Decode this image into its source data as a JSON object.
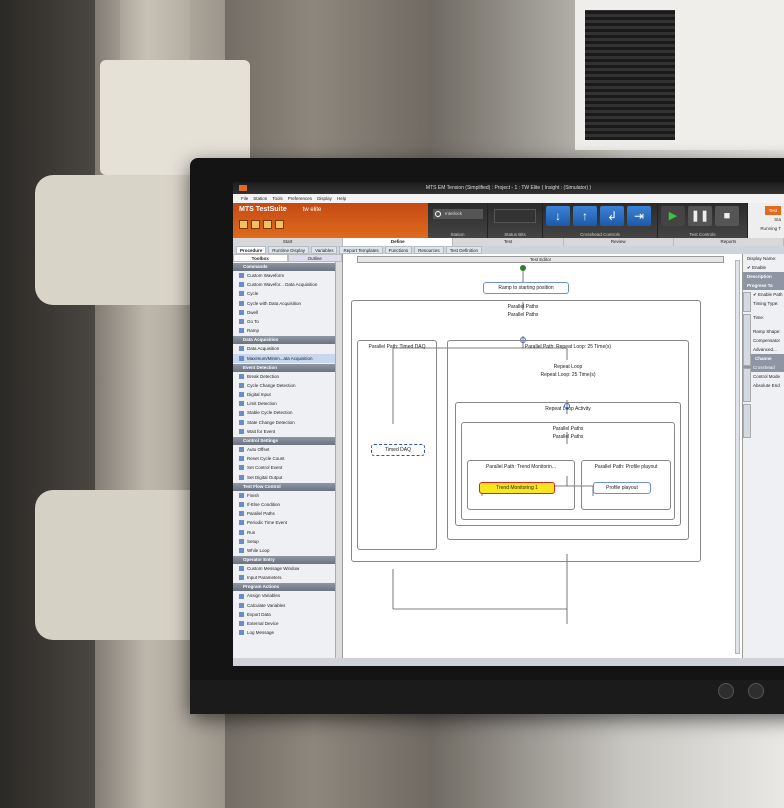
{
  "window": {
    "title": "MTS EM Tension (Simplified) : Project - 1 : TW Elite ( Insight : (Simulator) )"
  },
  "menu": [
    "File",
    "Station",
    "Tools",
    "Preferences",
    "Display",
    "Help"
  ],
  "brand": {
    "name": "MTS TestSuite",
    "edition": "tw elite"
  },
  "ribbon": {
    "station_field": "Interlock",
    "station_label": "Station",
    "status_bits_label": "Status Bits",
    "crosshead_label": "Crosshead Controls",
    "test_controls_label": "Test Controls",
    "right_top": "Test",
    "right_mid": "Sta",
    "right_bottom": "Running T"
  },
  "workflow_tabs": [
    "Start",
    "Define",
    "Test",
    "Review",
    "Reports"
  ],
  "define_tabs": [
    "Procedure",
    "Runtime Display",
    "Variables",
    "Report Templates",
    "Functions",
    "Resources",
    "Test Definition"
  ],
  "toolbox": {
    "tabs": [
      "Toolbox",
      "Outline"
    ],
    "sections": [
      {
        "title": "Commands",
        "items": [
          "Custom Waveform",
          "Custom Wavefor... Data Acquisition",
          "Cycle",
          "Cycle with Data Acquisition",
          "Dwell",
          "Go To",
          "Ramp"
        ]
      },
      {
        "title": "Data Acquisition",
        "items": [
          "Data Acquisition",
          "Maximum/Minim...ata Acquisition"
        ]
      },
      {
        "title": "Event Detection",
        "items": [
          "Break Detection",
          "Cycle Change Detection",
          "Digital Input",
          "Limit Detection",
          "Stable Cycle Detection",
          "State Change Detection",
          "Wait for Event"
        ]
      },
      {
        "title": "Control Settings",
        "items": [
          "Auto Offset",
          "Reset Cycle Count",
          "Set Control Event",
          "Set Digital Output"
        ]
      },
      {
        "title": "Test Flow Control",
        "items": [
          "Finish",
          "If-Else Condition",
          "Parallel Paths",
          "Periodic Time Event",
          "Run",
          "Setup",
          "While Loop"
        ]
      },
      {
        "title": "Operator Entry",
        "items": [
          "Custom Message Window",
          "Input Parameters"
        ]
      },
      {
        "title": "Program Actions",
        "items": [
          "Assign Variables",
          "Calculate Variables",
          "Export Data",
          "External Device",
          "Log Message"
        ]
      }
    ]
  },
  "editor": {
    "title": "Test Editor",
    "ramp": "Ramp to starting position",
    "parallel_paths": "Parallel Paths",
    "pp_timed_daq": "Parallel Path: Timed DAQ",
    "timed_daq": "Timed DAQ",
    "pp_repeat": "Parallel Path: Repeat Loop: 25 Time(s)",
    "repeat_loop": "Repeat Loop",
    "repeat_loop_sub": "Repeat Loop: 25 Time(s)",
    "repeat_activity": "Repeat Loop Activity",
    "pp_trend": "Parallel Path: Trend Monitorin...",
    "trend": "Trend Monitoring 1",
    "pp_profile": "Parallel Path: Profile playout",
    "profile": "Profile playout"
  },
  "properties": {
    "display_name": "Display Name:",
    "enable": "Enable",
    "description": "Description",
    "progress": "Progress Ta",
    "enable_path": "Enable Path",
    "timing_type": "Timing Type:",
    "time": "Time:",
    "ramp_shape": "Ramp Shape:",
    "compensator": "Compensator",
    "advanced": "Advanced...",
    "channels": "Channe",
    "crosshead": "Crosshead",
    "control_mode": "Control Mode",
    "absolute_end": "Absolute End",
    "vtabs": [
      "Ramp",
      "Data Acquisition",
      "Limit Detection",
      "Break Detection"
    ]
  },
  "colors": {
    "brand_orange": "#e06a1e",
    "trend_fill": "#f5e61f",
    "trend_border": "#d8241c",
    "node_border": "#6d8fd3"
  }
}
